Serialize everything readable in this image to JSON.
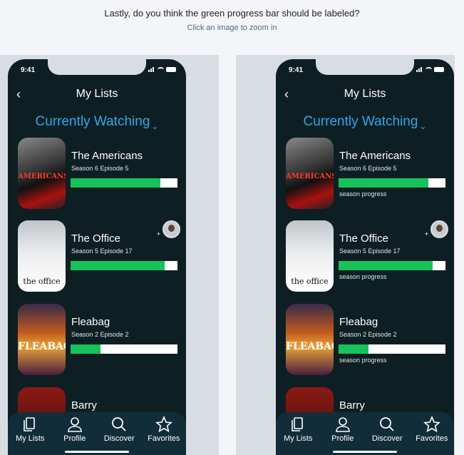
{
  "question": "Lastly, do you think the green progress bar should be labeled?",
  "hint": "Click an image to zoom in",
  "colors": {
    "accent": "#31a6e8",
    "progress": "#17c25a",
    "background": "#0e1f24",
    "tabbar": "#122d3a"
  },
  "phone": {
    "time": "9:41",
    "back_icon": "chevron-left-icon",
    "title": "My Lists",
    "section": "Currently Watching"
  },
  "shows": [
    {
      "name": "The Americans",
      "episode": "Season 6 Episode 5",
      "progress": 0.84
    },
    {
      "name": "The Office",
      "episode": "Season 5 Episode 17",
      "progress": 0.88,
      "shared": true,
      "poster_text": "the office"
    },
    {
      "name": "Fleabag",
      "episode": "Season 2 Episode 2",
      "progress": 0.28
    },
    {
      "name": "Barry"
    }
  ],
  "progress_label": "season progress",
  "tabs": [
    {
      "label": "My Lists",
      "icon": "list-stack-icon"
    },
    {
      "label": "Profile",
      "icon": "profile-icon"
    },
    {
      "label": "Discover",
      "icon": "search-icon"
    },
    {
      "label": "Favorites",
      "icon": "star-icon"
    }
  ]
}
